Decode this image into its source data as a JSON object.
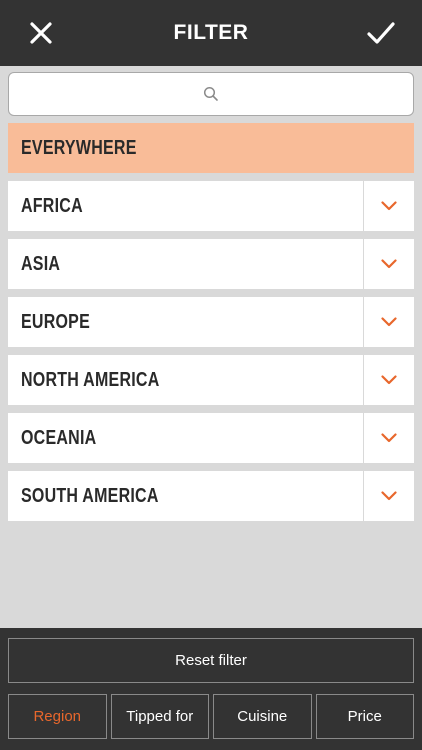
{
  "header": {
    "title": "FILTER",
    "close_icon": "close-icon",
    "done_icon": "checkmark-icon"
  },
  "search": {
    "placeholder": "",
    "value": "",
    "icon": "search-icon"
  },
  "everywhere": {
    "label": "EVERYWHERE",
    "selected": true
  },
  "regions": [
    {
      "label": "AFRICA",
      "icon": "chevron-down-icon"
    },
    {
      "label": "ASIA",
      "icon": "chevron-down-icon"
    },
    {
      "label": "EUROPE",
      "icon": "chevron-down-icon"
    },
    {
      "label": "NORTH AMERICA",
      "icon": "chevron-down-icon"
    },
    {
      "label": "OCEANIA",
      "icon": "chevron-down-icon"
    },
    {
      "label": "SOUTH AMERICA",
      "icon": "chevron-down-icon"
    }
  ],
  "footer": {
    "reset_label": "Reset filter",
    "tabs": [
      {
        "label": "Region",
        "active": true
      },
      {
        "label": "Tipped for",
        "active": false
      },
      {
        "label": "Cuisine",
        "active": false
      },
      {
        "label": "Price",
        "active": false
      }
    ]
  },
  "colors": {
    "accent": "#e8672c",
    "selected_row": "#f9bc98",
    "header_bg": "#333333",
    "page_bg": "#d9d9d9"
  }
}
